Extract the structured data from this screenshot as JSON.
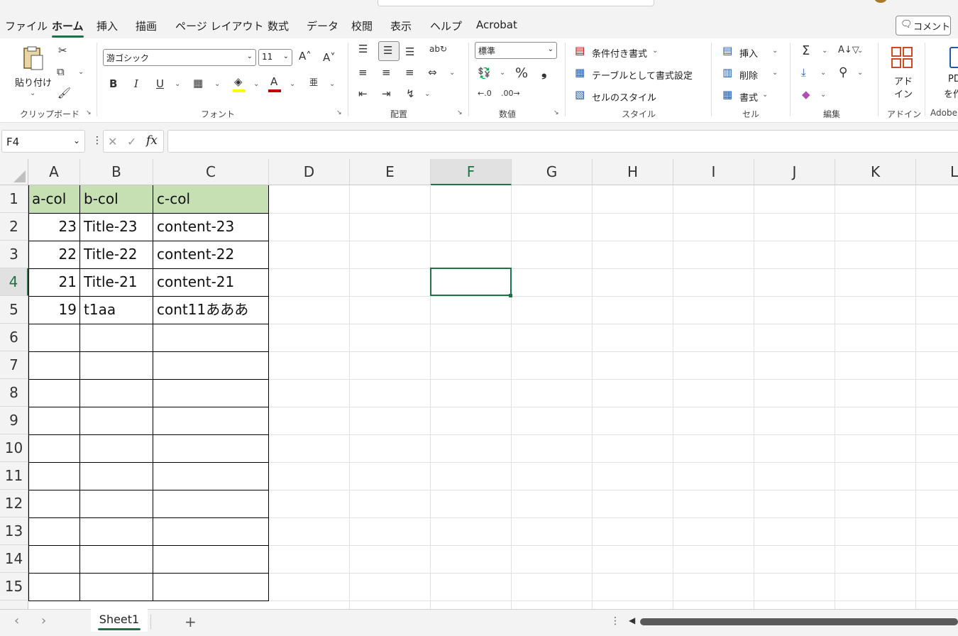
{
  "menu": {
    "tabs": [
      "ファイル",
      "ホーム",
      "挿入",
      "描画",
      "ページ レイアウト",
      "数式",
      "データ",
      "校閲",
      "表示",
      "ヘルプ",
      "Acrobat"
    ],
    "active_tab": "ホーム",
    "comment_label": "コメント"
  },
  "ribbon": {
    "clipboard": {
      "paste_label": "貼り付け",
      "group_label": "クリップボード"
    },
    "font": {
      "font_name": "游ゴシック",
      "font_size": "11",
      "bold": "B",
      "italic": "I",
      "underline": "U",
      "color_letter": "A",
      "group_label": "フォント"
    },
    "alignment": {
      "group_label": "配置"
    },
    "number": {
      "format": "標準",
      "percent": "%",
      "comma": "❟",
      "group_label": "数値"
    },
    "styles": {
      "conditional": "条件付き書式",
      "table": "テーブルとして書式設定",
      "cell_styles": "セルのスタイル",
      "group_label": "スタイル"
    },
    "cells": {
      "insert": "挿入",
      "delete": "削除",
      "format": "書式",
      "group_label": "セル"
    },
    "editing": {
      "group_label": "編集"
    },
    "addins": {
      "label_line1": "アド",
      "label_line2": "イン",
      "group_label": "アドイン"
    },
    "adobe": {
      "line1": "PD",
      "line2": "を作",
      "group_label": "Adobe"
    }
  },
  "formula_bar": {
    "name_box": "F4",
    "fx": "fx",
    "formula": ""
  },
  "grid": {
    "columns": [
      "A",
      "B",
      "C",
      "D",
      "E",
      "F",
      "G",
      "H",
      "I",
      "J",
      "K",
      "L"
    ],
    "rows": [
      "1",
      "2",
      "3",
      "4",
      "5",
      "6",
      "7",
      "8",
      "9",
      "10",
      "11",
      "12",
      "13",
      "14",
      "15"
    ],
    "selected_column": "F",
    "selected_row": "4",
    "header": [
      "a-col",
      "b-col",
      "c-col"
    ],
    "data": [
      [
        "23",
        "Title-23",
        "content-23"
      ],
      [
        "22",
        "Title-22",
        "content-22"
      ],
      [
        "21",
        "Title-21",
        "content-21"
      ],
      [
        "19",
        "t1aa",
        "cont11あああ"
      ]
    ]
  },
  "sheets": {
    "tabs": [
      "Sheet1"
    ],
    "add": "+"
  },
  "colors": {
    "accent": "#1f7244",
    "header_fill": "#c6e0b4",
    "font_red": "#c00000",
    "fill_yellow": "#ffff00"
  }
}
